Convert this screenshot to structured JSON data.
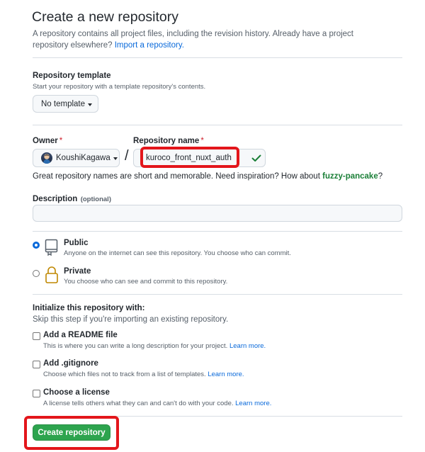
{
  "header": {
    "title": "Create a new repository",
    "subtitle_text": "A repository contains all project files, including the revision history. Already have a project repository elsewhere?",
    "import_link": "Import a repository."
  },
  "template": {
    "label": "Repository template",
    "note": "Start your repository with a template repository's contents.",
    "button_label": "No template"
  },
  "owner": {
    "label": "Owner",
    "required_mark": "*",
    "value": "KoushiKagawa",
    "separator": "/"
  },
  "repo_name": {
    "label": "Repository name",
    "required_mark": "*",
    "value": "kuroco_front_nuxt_auth",
    "status_icon": "check-icon",
    "status_color": "#1a7f37"
  },
  "name_hint": {
    "text": "Great repository names are short and memorable. Need inspiration? How about",
    "suggestion": "fuzzy-pancake",
    "suffix": "?"
  },
  "description": {
    "label": "Description",
    "optional": "(optional)",
    "value": ""
  },
  "visibility": {
    "public": {
      "label": "Public",
      "note": "Anyone on the internet can see this repository. You choose who can commit.",
      "icon": "repo-icon",
      "selected": true
    },
    "private": {
      "label": "Private",
      "note": "You choose who can see and commit to this repository.",
      "icon": "lock-icon",
      "selected": false
    }
  },
  "initialize": {
    "heading": "Initialize this repository with:",
    "note": "Skip this step if you're importing an existing repository.",
    "readme": {
      "label": "Add a README file",
      "note": "This is where you can write a long description for your project.",
      "link": "Learn more."
    },
    "gitignore": {
      "label": "Add .gitignore",
      "note": "Choose which files not to track from a list of templates.",
      "link": "Learn more."
    },
    "license": {
      "label": "Choose a license",
      "note": "A license tells others what they can and can't do with your code.",
      "link": "Learn more."
    }
  },
  "submit": {
    "label": "Create repository",
    "color": "#2da44e"
  },
  "colors": {
    "link": "#0969da",
    "highlight_box": "#e3161b",
    "lock_icon": "#bf8700"
  }
}
